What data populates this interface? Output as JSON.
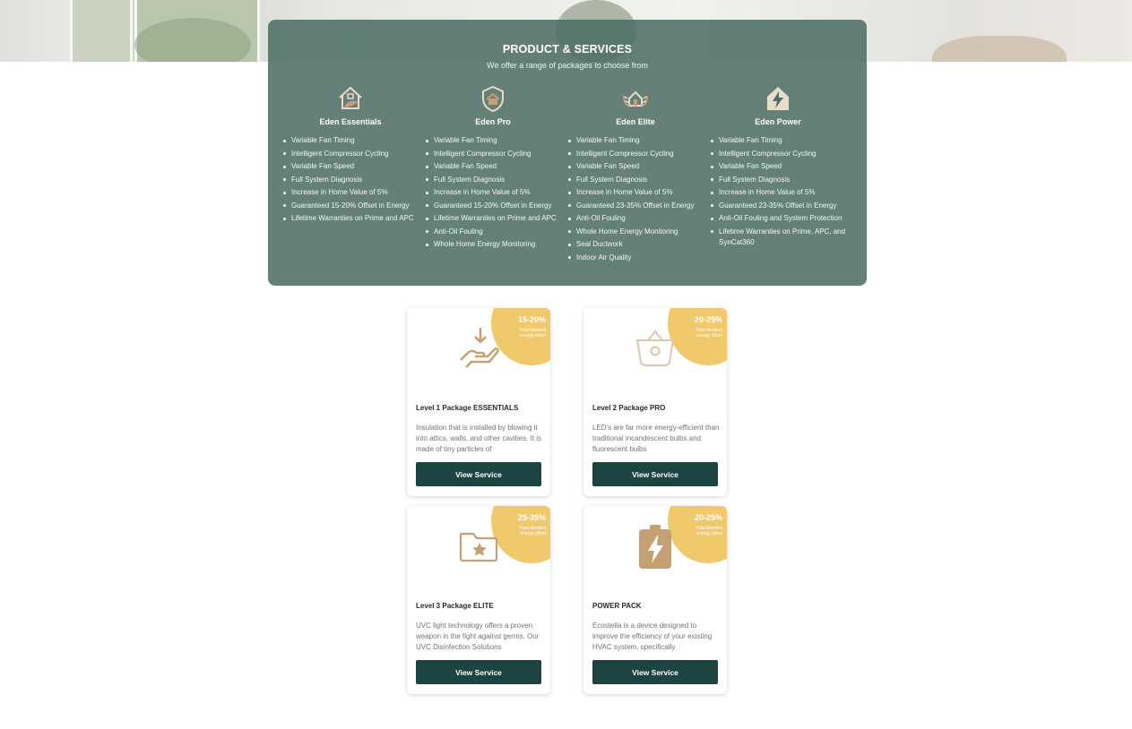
{
  "header": {
    "title": "PRODUCT & SERVICES",
    "subtitle": "We offer a range of packages to choose from"
  },
  "packages": [
    {
      "name": "Eden Essentials",
      "icon": "house-leaf-icon",
      "features": [
        "Variable Fan Timing",
        "Intelligent Compressor Cycling",
        "Variable Fan Speed",
        "Full System Diagnosis",
        "Increase in Home Value of 5%",
        "Guaranteed 15-20% Offset in Energy",
        "Lifetime Warranties on Prime and APC"
      ]
    },
    {
      "name": "Eden Pro",
      "icon": "house-shield-icon",
      "features": [
        "Variable Fan Timing",
        "Intelligent Compressor Cycling",
        "Variable Fan Speed",
        "Full System Diagnosis",
        "Increase in Home Value of 5%",
        "Guaranteed 15-20% Offset in Energy",
        "Lifetime Warranties on Prime and APC",
        "Anti-Oil Fouling",
        "Whole Home Energy Monitoring"
      ]
    },
    {
      "name": "Eden Elite",
      "icon": "house-laurel-icon",
      "features": [
        "Variable Fan Timing",
        "Intelligent Compressor Cycling",
        "Variable Fan Speed",
        "Full System Diagnosis",
        "Increase in Home Value of 5%",
        "Guaranteed 23-35% Offset in Energy",
        "Anti-Oil Fouling",
        "Whole Home Energy Monitoring",
        "Seal Ductwork",
        "Indoor Air Quality"
      ]
    },
    {
      "name": "Eden Power",
      "icon": "house-bolt-icon",
      "features": [
        "Variable Fan Timing",
        "Intelligent Compressor Cycling",
        "Variable Fan Speed",
        "Full System Diagnosis",
        "Increase in Home Value of 5%",
        "Guaranteed 23-35% Offset in Energy",
        "Anti-Oil Fouling and System Protection",
        "Lifetime Warranties on Prime, APC, and SynCat360"
      ]
    }
  ],
  "cards": [
    {
      "badge_value": "15-20%",
      "badge_label": "Total blended energy offset",
      "icon": "hand-download-icon",
      "title": "Level 1 Package ESSENTIALS",
      "description": "Insulation that is installed by blowing it into attics, walls, and other cavities. It is made of tiny particles of",
      "button": "View Service"
    },
    {
      "badge_value": "20-25%",
      "badge_label": "Total blended energy offset",
      "icon": "basket-icon",
      "title": "Level 2 Package PRO",
      "description": "LED's are far more energy-efficient than traditional incandescent bulbs and fluorescent bulbs",
      "button": "View Service"
    },
    {
      "badge_value": "25-35%",
      "badge_label": "Total blended energy offset",
      "icon": "folder-star-icon",
      "title": "Level 3 Package ELITE",
      "description": "UVC light technology offers a proven weapon in the fight against germs. Our UVC Disinfection Solutions",
      "button": "View Service"
    },
    {
      "badge_value": "20-25%",
      "badge_label": "Total blended energy offset",
      "icon": "battery-bolt-icon",
      "title": "POWER PACK",
      "description": "Ecostella is a device designed to improve the efficiency of your existing HVAC system, specifically",
      "button": "View Service"
    }
  ],
  "colors": {
    "panel": "#4e6e67",
    "badge": "#f0c96c",
    "button": "#1c4442",
    "icon_accent": "#c4a074"
  }
}
